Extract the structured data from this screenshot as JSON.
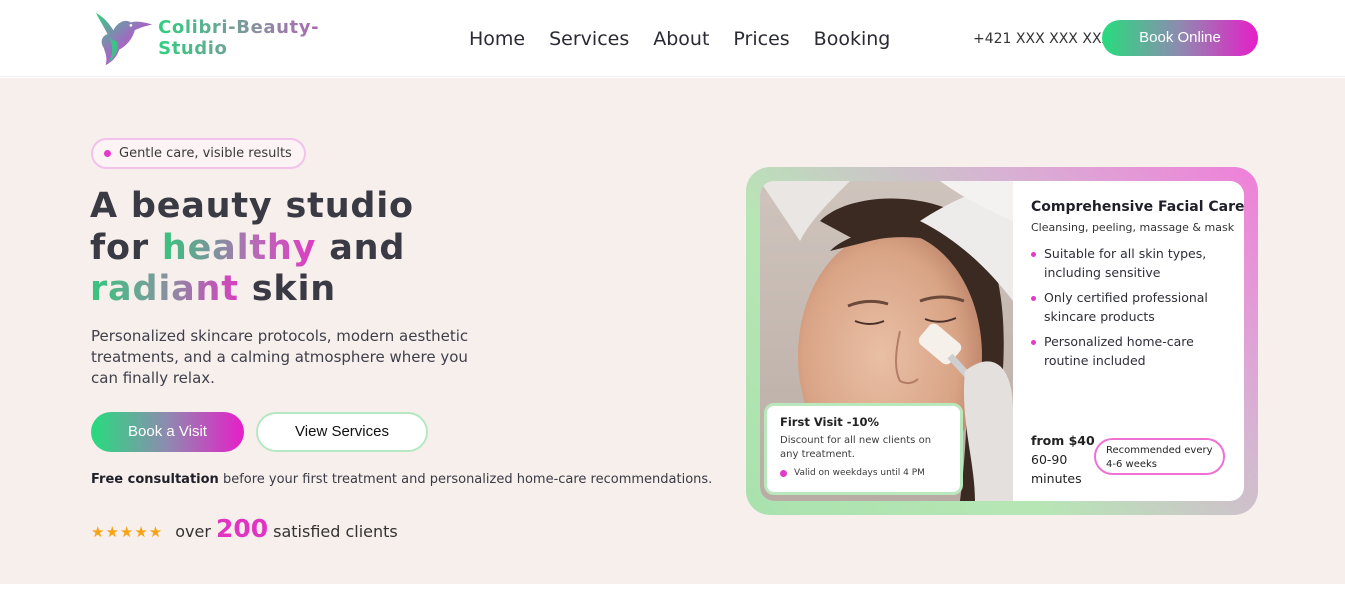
{
  "nav": {
    "brand": "Colibri-Beauty-Studio",
    "links": [
      "Home",
      "Services",
      "About",
      "Prices",
      "Booking"
    ],
    "phone": "+421 XXX XXX XXX",
    "cta": "Book Online"
  },
  "hero": {
    "badge": "Gentle care, visible results",
    "headline": {
      "line1": "A beauty studio",
      "line2_a": "for ",
      "line2_b": "healthy",
      "line2_c": " and",
      "line3_a": "radiant",
      "line3_b": " skin"
    },
    "lead": "Personalized skincare protocols, modern aesthetic treatments, and a calming atmosphere where you can finally relax.",
    "primary_button": "Book a Visit",
    "secondary_button": "View Services",
    "consult_bold": "Free consultation",
    "consult_rest": " before your first treatment and personalized home-care recommendations.",
    "rating": {
      "stars": "★★★★★",
      "stars_value": 5,
      "prefix": "over",
      "count": "200",
      "suffix": "satisfied clients"
    }
  },
  "card": {
    "title": "Comprehensive Facial Care",
    "subtitle": "Cleansing, peeling, massage & mask",
    "features": [
      "Suitable for all skin types, including sensitive",
      "Only certified professional skincare products",
      "Personalized home-care routine included"
    ],
    "price_from": "from $40",
    "duration": "60-90",
    "duration_unit": "minutes",
    "recommendation": "Recommended every 4-6 weeks",
    "promo": {
      "title": "First Visit -10%",
      "text": "Discount for all new clients on any treatment.",
      "valid": "Valid on weekdays until 4 PM"
    }
  },
  "colors": {
    "accent_green": "#33c97d",
    "accent_pink": "#e034c2",
    "hero_bg": "#f7efec",
    "star": "#f5a417"
  },
  "icons": {
    "logo": "hummingbird-logo",
    "bullet": "pink-dot",
    "rating": "star-icon"
  }
}
